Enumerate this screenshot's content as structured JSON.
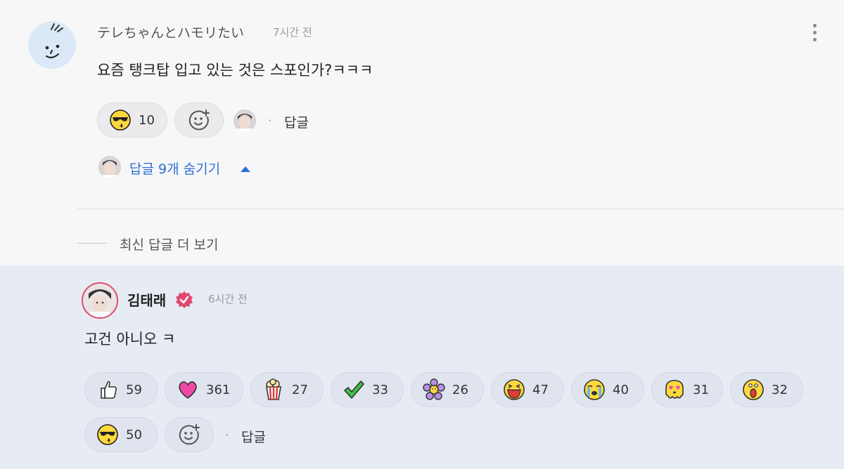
{
  "comment": {
    "username": "テレちゃんとハモリたい",
    "time": "7시간 전",
    "text": "요즘 탱크탑 입고 있는 것은 스포인가?ㅋㅋㅋ",
    "reaction": {
      "icon": "sunglasses-kiss-emoji",
      "count": "10"
    },
    "reply_label": "답글",
    "hide_replies_label": "답글 9개 숨기기"
  },
  "more_replies_label": "최신 답글 더 보기",
  "reply": {
    "username": "김태래",
    "time": "6시간 전",
    "text": "고건 아니오 ㅋ",
    "reactions": [
      {
        "icon": "thumbs-up-emoji",
        "count": "59"
      },
      {
        "icon": "heart-emoji",
        "count": "361"
      },
      {
        "icon": "popcorn-emoji",
        "count": "27"
      },
      {
        "icon": "checkmark-emoji",
        "count": "33"
      },
      {
        "icon": "flower-emoji",
        "count": "26"
      },
      {
        "icon": "laughing-emoji",
        "count": "47"
      },
      {
        "icon": "crying-emoji",
        "count": "40"
      },
      {
        "icon": "heart-eyes-emoji",
        "count": "31"
      },
      {
        "icon": "shocked-emoji",
        "count": "32"
      },
      {
        "icon": "sunglasses-kiss-emoji",
        "count": "50"
      }
    ],
    "reply_label": "답글"
  },
  "colors": {
    "accent_blue": "#2b6fd6",
    "verified_pink": "#e04a6f",
    "reply_background": "#e7ebf4"
  }
}
